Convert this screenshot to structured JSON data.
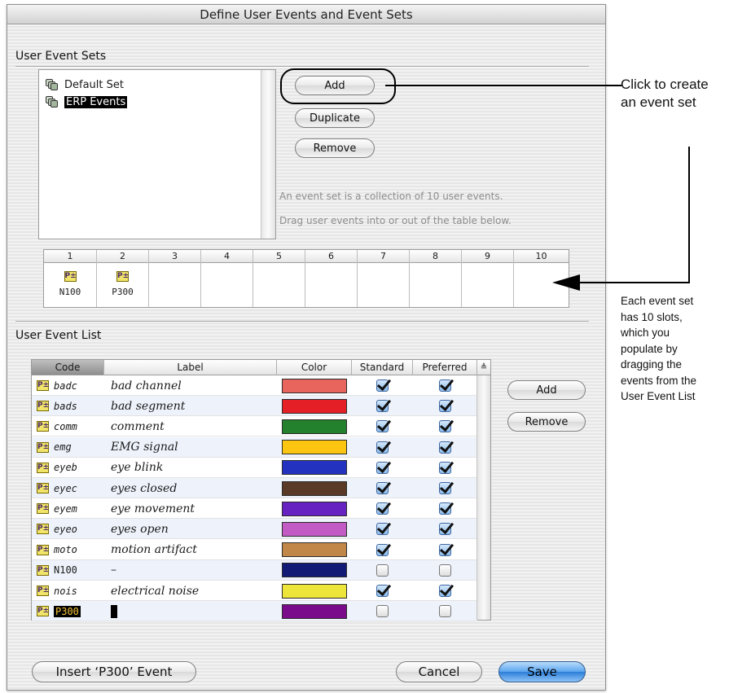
{
  "dialog": {
    "title": "Define User Events and Event Sets"
  },
  "sets": {
    "title": "User Event Sets",
    "items": [
      {
        "label": "Default Set",
        "selected": false
      },
      {
        "label": "ERP Events",
        "selected": true
      }
    ],
    "buttons": {
      "add": "Add",
      "duplicate": "Duplicate",
      "remove": "Remove"
    },
    "info_line1": "An event set is a collection of 10 user events.",
    "info_line2": "Drag user events into or out of the table below."
  },
  "slots": {
    "headers": [
      "1",
      "2",
      "3",
      "4",
      "5",
      "6",
      "7",
      "8",
      "9",
      "10"
    ],
    "events": [
      "N100",
      "P300",
      "",
      "",
      "",
      "",
      "",
      "",
      "",
      ""
    ]
  },
  "list": {
    "title": "User Event List",
    "columns": {
      "code": "Code",
      "label": "Label",
      "color": "Color",
      "standard": "Standard",
      "preferred": "Preferred"
    },
    "rows": [
      {
        "code": "badc",
        "label": "bad channel",
        "color": "#e8655e",
        "standard": true,
        "preferred": true
      },
      {
        "code": "bads",
        "label": "bad segment",
        "color": "#e41f26",
        "standard": true,
        "preferred": true
      },
      {
        "code": "comm",
        "label": "comment",
        "color": "#23802c",
        "standard": true,
        "preferred": true
      },
      {
        "code": "emg",
        "label": "EMG signal",
        "color": "#fcc512",
        "standard": true,
        "preferred": true
      },
      {
        "code": "eyeb",
        "label": "eye blink",
        "color": "#2432c0",
        "standard": true,
        "preferred": true
      },
      {
        "code": "eyec",
        "label": "eyes closed",
        "color": "#5a3a26",
        "standard": true,
        "preferred": true
      },
      {
        "code": "eyem",
        "label": "eye movement",
        "color": "#6722c2",
        "standard": true,
        "preferred": true
      },
      {
        "code": "eyeo",
        "label": "eyes open",
        "color": "#c25cc4",
        "standard": true,
        "preferred": true
      },
      {
        "code": "moto",
        "label": "motion artifact",
        "color": "#c08748",
        "standard": true,
        "preferred": true
      },
      {
        "code": "N100",
        "label": "–",
        "color": "#111a75",
        "standard": false,
        "preferred": false
      },
      {
        "code": "nois",
        "label": "electrical noise",
        "color": "#eee53a",
        "standard": true,
        "preferred": true
      },
      {
        "code": "P300",
        "label": "",
        "color": "#7a0b8a",
        "standard": false,
        "preferred": false
      }
    ],
    "buttons": {
      "add": "Add",
      "remove": "Remove"
    }
  },
  "footer": {
    "insert": "Insert ‘P300’ Event",
    "cancel": "Cancel",
    "save": "Save"
  },
  "annotations": {
    "create_line1": "Click to create",
    "create_line2": "an event set",
    "slots_note": [
      "Each event set",
      "has 10 slots,",
      "which you",
      "populate by",
      "dragging the",
      "events from the",
      "User Event List"
    ]
  }
}
